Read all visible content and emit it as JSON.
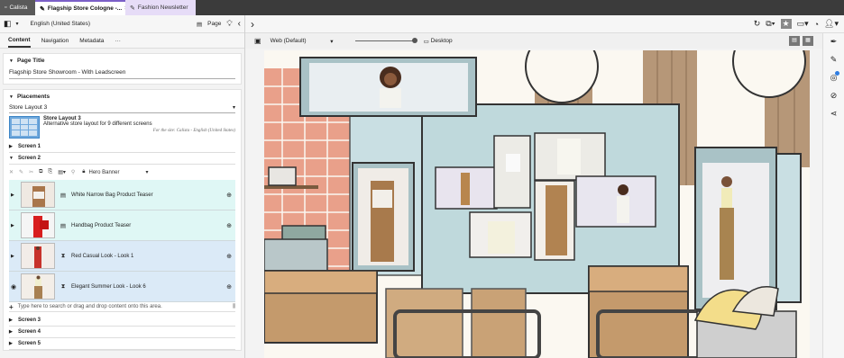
{
  "tabs": [
    {
      "label": "Calista",
      "icon": "page-icon"
    },
    {
      "label": "Flagship Store Cologne -...",
      "icon": "pencil-icon",
      "close": "×"
    },
    {
      "label": "Fashion Newsletter",
      "icon": "pencil-icon"
    }
  ],
  "left_toolbar": {
    "locale": "English (United States)",
    "page_label": "Page"
  },
  "content_tabs": [
    "Content",
    "Navigation",
    "Metadata",
    "···"
  ],
  "page_title": {
    "heading": "Page Title",
    "value": "Flagship Store Showroom - With Leadscreen"
  },
  "placements": {
    "heading": "Placements",
    "layout_select": "Store Layout 3",
    "layout_title": "Store Layout 3",
    "layout_description": "Alternative store layout for 9 different screens",
    "layout_note": "For the site: Calista - English (United States)",
    "screens_before": [
      "Screen 1",
      "Screen 2"
    ],
    "banner_type": "Hero Banner",
    "items": [
      {
        "label": "White Narrow Bag Product Teaser",
        "type_icon": "document-icon"
      },
      {
        "label": "Handbag Product Teaser",
        "type_icon": "document-icon"
      },
      {
        "label": "Red Casual Look - Look 1",
        "type_icon": "hourglass-icon"
      },
      {
        "label": "Elegant Summer Look - Look 6",
        "type_icon": "hourglass-icon"
      }
    ],
    "drop_hint": "Type here to search or drag and drop content onto this area.",
    "screens_after": [
      "Screen 3",
      "Screen 4",
      "Screen 5"
    ]
  },
  "preview_bar": {
    "device_select": "Web (Default)",
    "viewport_label": "Desktop"
  },
  "colors": {
    "accent": "#7b5fc7",
    "row_cyan": "#dff7f5",
    "row_blue": "#dbeaf7"
  }
}
